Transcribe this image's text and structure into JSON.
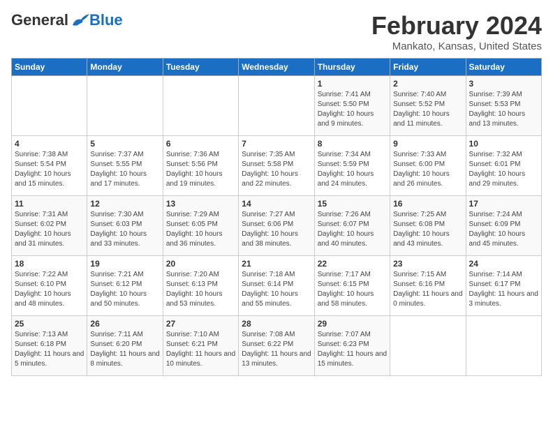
{
  "logo": {
    "general": "General",
    "blue": "Blue"
  },
  "title": "February 2024",
  "subtitle": "Mankato, Kansas, United States",
  "days_of_week": [
    "Sunday",
    "Monday",
    "Tuesday",
    "Wednesday",
    "Thursday",
    "Friday",
    "Saturday"
  ],
  "weeks": [
    [
      {
        "day": "",
        "details": ""
      },
      {
        "day": "",
        "details": ""
      },
      {
        "day": "",
        "details": ""
      },
      {
        "day": "",
        "details": ""
      },
      {
        "day": "1",
        "details": "Sunrise: 7:41 AM\nSunset: 5:50 PM\nDaylight: 10 hours\nand 9 minutes."
      },
      {
        "day": "2",
        "details": "Sunrise: 7:40 AM\nSunset: 5:52 PM\nDaylight: 10 hours\nand 11 minutes."
      },
      {
        "day": "3",
        "details": "Sunrise: 7:39 AM\nSunset: 5:53 PM\nDaylight: 10 hours\nand 13 minutes."
      }
    ],
    [
      {
        "day": "4",
        "details": "Sunrise: 7:38 AM\nSunset: 5:54 PM\nDaylight: 10 hours\nand 15 minutes."
      },
      {
        "day": "5",
        "details": "Sunrise: 7:37 AM\nSunset: 5:55 PM\nDaylight: 10 hours\nand 17 minutes."
      },
      {
        "day": "6",
        "details": "Sunrise: 7:36 AM\nSunset: 5:56 PM\nDaylight: 10 hours\nand 19 minutes."
      },
      {
        "day": "7",
        "details": "Sunrise: 7:35 AM\nSunset: 5:58 PM\nDaylight: 10 hours\nand 22 minutes."
      },
      {
        "day": "8",
        "details": "Sunrise: 7:34 AM\nSunset: 5:59 PM\nDaylight: 10 hours\nand 24 minutes."
      },
      {
        "day": "9",
        "details": "Sunrise: 7:33 AM\nSunset: 6:00 PM\nDaylight: 10 hours\nand 26 minutes."
      },
      {
        "day": "10",
        "details": "Sunrise: 7:32 AM\nSunset: 6:01 PM\nDaylight: 10 hours\nand 29 minutes."
      }
    ],
    [
      {
        "day": "11",
        "details": "Sunrise: 7:31 AM\nSunset: 6:02 PM\nDaylight: 10 hours\nand 31 minutes."
      },
      {
        "day": "12",
        "details": "Sunrise: 7:30 AM\nSunset: 6:03 PM\nDaylight: 10 hours\nand 33 minutes."
      },
      {
        "day": "13",
        "details": "Sunrise: 7:29 AM\nSunset: 6:05 PM\nDaylight: 10 hours\nand 36 minutes."
      },
      {
        "day": "14",
        "details": "Sunrise: 7:27 AM\nSunset: 6:06 PM\nDaylight: 10 hours\nand 38 minutes."
      },
      {
        "day": "15",
        "details": "Sunrise: 7:26 AM\nSunset: 6:07 PM\nDaylight: 10 hours\nand 40 minutes."
      },
      {
        "day": "16",
        "details": "Sunrise: 7:25 AM\nSunset: 6:08 PM\nDaylight: 10 hours\nand 43 minutes."
      },
      {
        "day": "17",
        "details": "Sunrise: 7:24 AM\nSunset: 6:09 PM\nDaylight: 10 hours\nand 45 minutes."
      }
    ],
    [
      {
        "day": "18",
        "details": "Sunrise: 7:22 AM\nSunset: 6:10 PM\nDaylight: 10 hours\nand 48 minutes."
      },
      {
        "day": "19",
        "details": "Sunrise: 7:21 AM\nSunset: 6:12 PM\nDaylight: 10 hours\nand 50 minutes."
      },
      {
        "day": "20",
        "details": "Sunrise: 7:20 AM\nSunset: 6:13 PM\nDaylight: 10 hours\nand 53 minutes."
      },
      {
        "day": "21",
        "details": "Sunrise: 7:18 AM\nSunset: 6:14 PM\nDaylight: 10 hours\nand 55 minutes."
      },
      {
        "day": "22",
        "details": "Sunrise: 7:17 AM\nSunset: 6:15 PM\nDaylight: 10 hours\nand 58 minutes."
      },
      {
        "day": "23",
        "details": "Sunrise: 7:15 AM\nSunset: 6:16 PM\nDaylight: 11 hours\nand 0 minutes."
      },
      {
        "day": "24",
        "details": "Sunrise: 7:14 AM\nSunset: 6:17 PM\nDaylight: 11 hours\nand 3 minutes."
      }
    ],
    [
      {
        "day": "25",
        "details": "Sunrise: 7:13 AM\nSunset: 6:18 PM\nDaylight: 11 hours\nand 5 minutes."
      },
      {
        "day": "26",
        "details": "Sunrise: 7:11 AM\nSunset: 6:20 PM\nDaylight: 11 hours\nand 8 minutes."
      },
      {
        "day": "27",
        "details": "Sunrise: 7:10 AM\nSunset: 6:21 PM\nDaylight: 11 hours\nand 10 minutes."
      },
      {
        "day": "28",
        "details": "Sunrise: 7:08 AM\nSunset: 6:22 PM\nDaylight: 11 hours\nand 13 minutes."
      },
      {
        "day": "29",
        "details": "Sunrise: 7:07 AM\nSunset: 6:23 PM\nDaylight: 11 hours\nand 15 minutes."
      },
      {
        "day": "",
        "details": ""
      },
      {
        "day": "",
        "details": ""
      }
    ]
  ]
}
